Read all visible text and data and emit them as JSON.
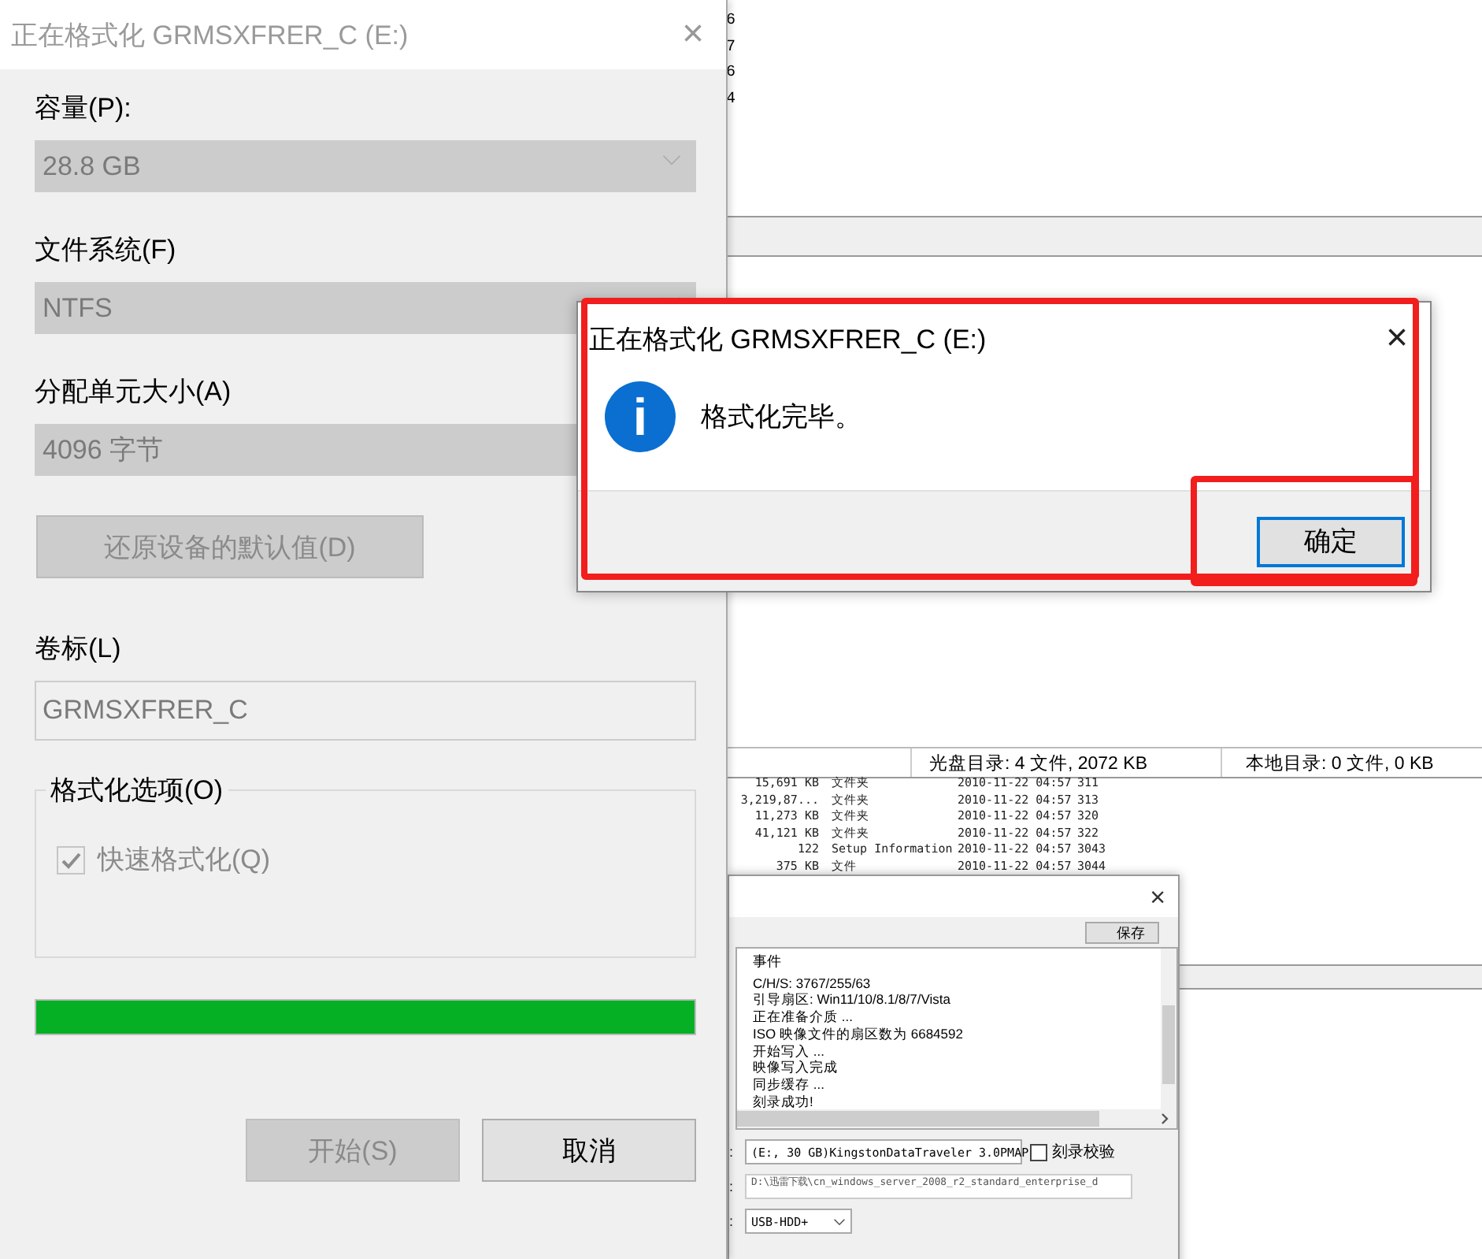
{
  "background_app": {
    "top_rows": [
      "6",
      "7",
      "6",
      "4"
    ],
    "status": [
      "光盘目录: 4 文件, 2072 KB",
      "本地目录: 0 文件, 0 KB"
    ],
    "file_rows": [
      {
        "size": "15,691 KB",
        "type": "文件夹",
        "date": "2010-11-22 04:57",
        "column_4": "311"
      },
      {
        "size": "3,219,87...",
        "type": "文件夹",
        "date": "2010-11-22 04:57",
        "column_4": "313"
      },
      {
        "size": "11,273 KB",
        "type": "文件夹",
        "date": "2010-11-22 04:57",
        "column_4": "320"
      },
      {
        "size": "41,121 KB",
        "type": "文件夹",
        "date": "2010-11-22 04:57",
        "column_4": "322"
      },
      {
        "size": "122",
        "type": "Setup Information",
        "date": "2010-11-22 04:57",
        "column_4": "3043"
      },
      {
        "size": "375 KB",
        "type": "文件",
        "date": "2010-11-22 04:57",
        "column_4": "3044"
      }
    ]
  },
  "burn_dialog": {
    "close": "×",
    "save_button": "保存",
    "log": {
      "header": "事件",
      "lines": [
        "C/H/S: 3767/255/63",
        "引导扇区: Win11/10/8.1/8/7/Vista",
        "正在准备介质 ...",
        "ISO 映像文件的扇区数为 6684592",
        "开始写入 ...",
        "映像写入完成",
        "同步缓存 ...",
        "刻录成功!"
      ]
    },
    "rows": [
      {
        "kind": "select",
        "label_tail": ":",
        "value": "(E:, 30 GB)KingstonDataTraveler 3.0PMAP",
        "checkbox": {
          "label": "刻录校验",
          "checked": false
        }
      },
      {
        "kind": "field",
        "label_tail": ":",
        "value": "D:\\迅雷下载\\cn_windows_server_2008_r2_standard_enterprise_d"
      },
      {
        "kind": "select",
        "label_tail": ":",
        "value": "USB-HDD+"
      }
    ]
  },
  "format_dialog": {
    "title": "正在格式化 GRMSXFRER_C (E:)",
    "close": "×",
    "fields": [
      {
        "kind": "select",
        "label": "容量(P):",
        "value": "28.8 GB",
        "disabled": true
      },
      {
        "kind": "select",
        "label": "文件系统(F)",
        "value": "NTFS",
        "disabled": true
      },
      {
        "kind": "select",
        "label": "分配单元大小(A)",
        "value": "4096 字节",
        "disabled": true,
        "arrow": false
      }
    ],
    "restore_button": {
      "label": "还原设备的默认值(D)",
      "disabled": true
    },
    "volume": {
      "label": "卷标(L)",
      "value": "GRMSXFRER_C",
      "disabled": true
    },
    "options": {
      "legend": "格式化选项(O)",
      "quick_format": {
        "label": "快速格式化(Q)",
        "checked": true,
        "disabled": true
      }
    },
    "progress": {
      "level": 1
    },
    "buttons": [
      {
        "label": "开始(S)",
        "disabled": true
      },
      {
        "label": "取消",
        "disabled": false
      }
    ]
  },
  "message_box": {
    "title": "正在格式化 GRMSXFRER_C (E:)",
    "close": "×",
    "icon_letter": "i",
    "message": "格式化完毕。",
    "button": {
      "label": "确定",
      "focused": true
    }
  }
}
